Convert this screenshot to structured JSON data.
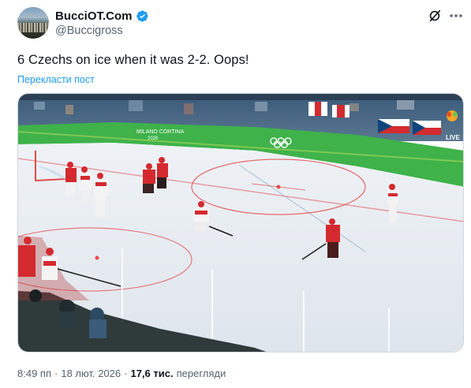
{
  "author": {
    "display_name": "BucciOT.Com",
    "handle": "@Buccigross",
    "verified": true
  },
  "tweet": {
    "text": "6 Czechs on ice when it was 2-2. Oops!",
    "translate_label": "Перекласти пост"
  },
  "media": {
    "rink_board_text": "MILANO CORTINA",
    "rink_board_year": "2026",
    "broadcaster_label": "LIVE"
  },
  "meta": {
    "time": "8:49 пп",
    "separator": "·",
    "date": "18 лют. 2026",
    "views_count": "17,6 тис.",
    "views_label": "перегляди"
  },
  "colors": {
    "link": "#1d9bf0",
    "verified": "#1d9bf0",
    "secondary_text": "#536471",
    "board_green": "#3fb24a",
    "czech_red": "#d42a2f"
  },
  "icons": {
    "verified": "verified-badge-icon",
    "grok": "grok-icon",
    "more": "more-icon"
  }
}
